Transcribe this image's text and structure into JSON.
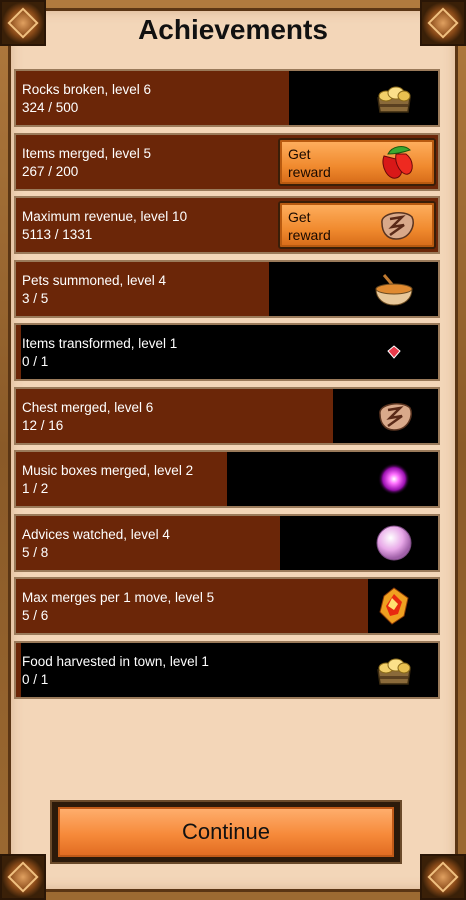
{
  "title": "Achievements",
  "achievements": [
    {
      "name": "Rocks broken, level 6",
      "progress": "324 / 500",
      "fraction": 0.648,
      "icon": "gold-chest-icon",
      "reward": false
    },
    {
      "name": "Items merged, level 5",
      "progress": "267 / 200",
      "fraction": 1.0,
      "icon": "red-pepper-icon",
      "reward": true,
      "reward_label": "Get\nreward"
    },
    {
      "name": "Maximum revenue, level 10",
      "progress": "5113 / 1331",
      "fraction": 1.0,
      "icon": "rune-stone-icon",
      "reward": true,
      "reward_label": "Get\nreward"
    },
    {
      "name": "Pets summoned, level 4",
      "progress": "3 / 5",
      "fraction": 0.6,
      "icon": "food-bowl-icon",
      "reward": false
    },
    {
      "name": "Items transformed, level 1",
      "progress": "0 / 1",
      "fraction": 0.0,
      "icon": "red-gem-icon",
      "reward": false
    },
    {
      "name": "Chest merged, level 6",
      "progress": "12 / 16",
      "fraction": 0.75,
      "icon": "rune-stone-icon",
      "reward": false
    },
    {
      "name": "Music boxes merged, level 2",
      "progress": "1 / 2",
      "fraction": 0.5,
      "icon": "purple-orb-icon",
      "reward": false
    },
    {
      "name": "Advices watched, level 4",
      "progress": "5 / 8",
      "fraction": 0.625,
      "icon": "pearl-icon",
      "reward": false
    },
    {
      "name": "Max merges per 1 move, level 5",
      "progress": "5 / 6",
      "fraction": 0.833,
      "icon": "fire-crystal-icon",
      "reward": false
    },
    {
      "name": "Food harvested in town, level 1",
      "progress": "0 / 1",
      "fraction": 0.0,
      "icon": "gold-chest-icon",
      "reward": false
    }
  ],
  "continue_label": "Continue"
}
